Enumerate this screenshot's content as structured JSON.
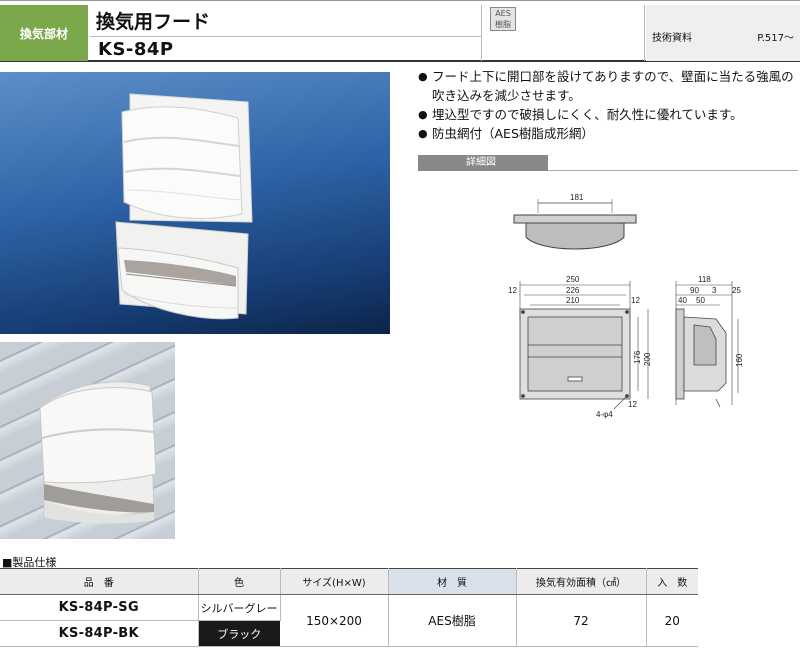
{
  "header": {
    "category": "換気部材",
    "product_name": "換気用フード",
    "model": "KS-84P",
    "material_badge_line1": "AES",
    "material_badge_line2": "樹脂",
    "tech_label": "技術資料",
    "tech_page": "P.517～"
  },
  "features": [
    "フード上下に開口部を設けてありますので、壁面に当たる強風の吹き込みを減少させます。",
    "埋込型ですので破損しにくく、耐久性に優れています。",
    "防虫網付（AES樹脂成形網）"
  ],
  "detail": {
    "label": "詳細図",
    "dims": {
      "top_width": "181",
      "overall_width": "250",
      "mid_width": "226",
      "inner_width": "210",
      "side_margin_left": "12",
      "side_margin_right": "12",
      "height_176": "176",
      "height_200": "200",
      "bottom_12": "12",
      "hole": "4-φ4",
      "depth_118": "118",
      "depth_90": "90",
      "depth_3": "3",
      "depth_25": "25",
      "depth_40": "40",
      "depth_50": "50",
      "side_height": "160"
    }
  },
  "spec": {
    "title": "■製品仕様",
    "headers": [
      "品　番",
      "色",
      "サイズ(H×W)",
      "材　質",
      "換気有効面積（㎠）",
      "入　数"
    ],
    "rows": [
      {
        "model": "KS-84P-SG",
        "color": "シルバーグレー"
      },
      {
        "model": "KS-84P-BK",
        "color": "ブラック"
      }
    ],
    "size": "150×200",
    "material": "AES樹脂",
    "area": "72",
    "quantity": "20"
  }
}
